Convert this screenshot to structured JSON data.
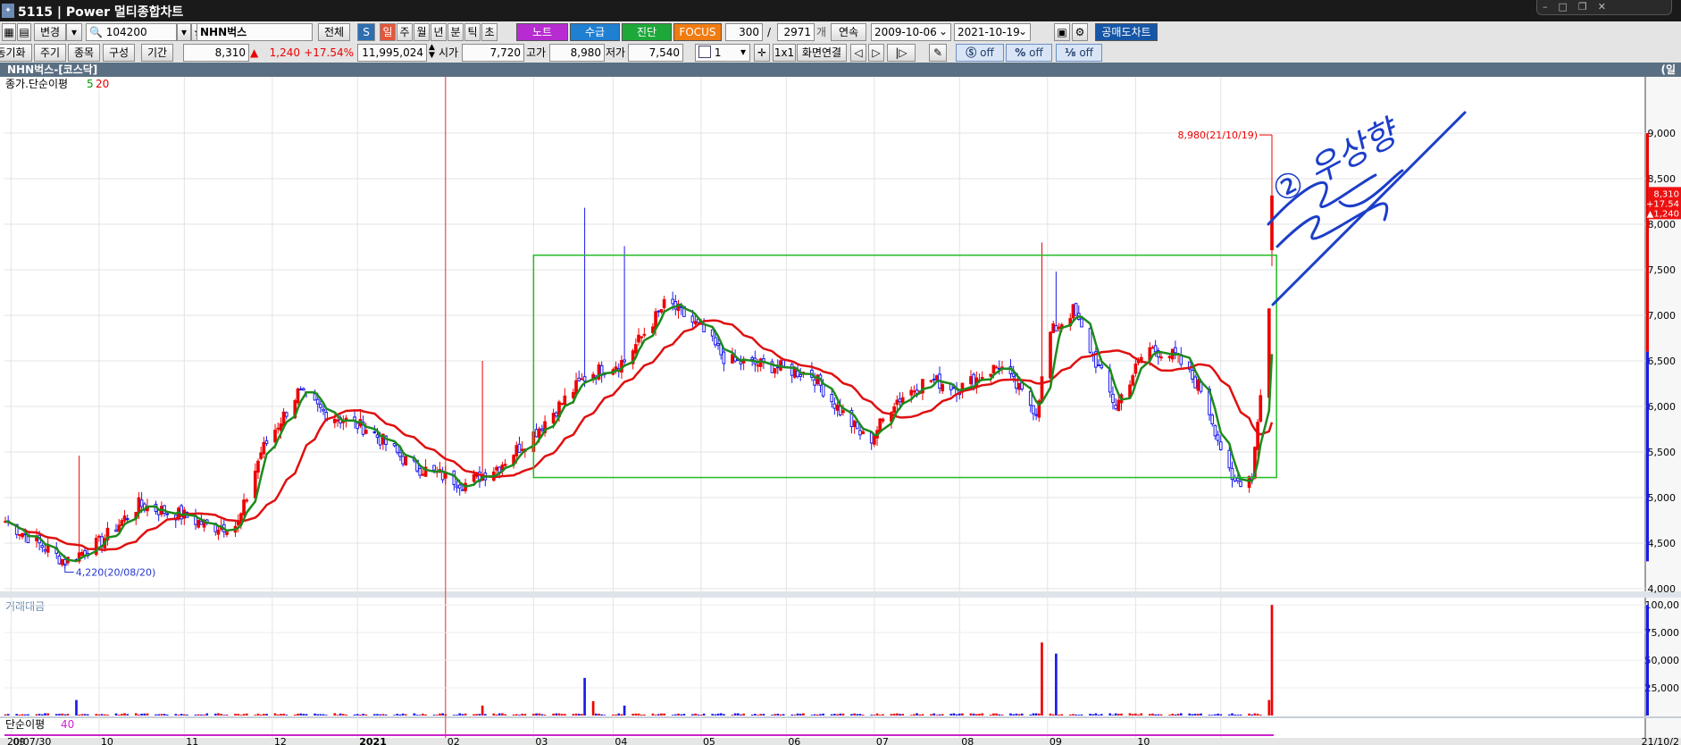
{
  "window": {
    "id": "5115",
    "title": "Power 멀티종합차트"
  },
  "toolbar1": {
    "change_label": "변경",
    "code": "104200",
    "name": "NHN벅스",
    "all_label": "전체",
    "periods": [
      "일",
      "주",
      "월",
      "년",
      "분",
      "틱",
      "초"
    ],
    "note_label": "노트",
    "supply_label": "수급",
    "diag_label": "진단",
    "focus_label": "FOCUS",
    "count": "300",
    "slash": "/",
    "total": "2971",
    "count_unit": "개",
    "continuous_label": "연속",
    "date_from": "2009-10-06",
    "date_to": "2021-10-19",
    "short_sell_label": "공매도차트"
  },
  "toolbar2": {
    "sync_label": "동기화",
    "cycle_label": "주기",
    "stock_label": "종목",
    "compose_label": "구성",
    "period_label": "기간",
    "price": "8,310",
    "change_arrow": "▲",
    "change": "1,240",
    "change_pct": "+17.54%",
    "volume": "11,995,024",
    "open_label": "시가",
    "open": "7,720",
    "high_label": "고가",
    "high": "8,980",
    "low_label": "저가",
    "low": "7,540",
    "spin_value": "1",
    "ratio_label": "1x1",
    "screen_link_label": "화면연결",
    "off1": "off",
    "off2": "off",
    "off3": "off"
  },
  "panel_title": "NHN벅스-[코스닥]",
  "panel_title_right": "(일",
  "chart_data": {
    "type": "candlestick",
    "main_legend": {
      "name": "종가.단순이평",
      "p1": "5",
      "p2": "20",
      "p1_color": "#009900",
      "p2_color": "#ee0000"
    },
    "volume_legend": "거래대금",
    "bottom_legend": {
      "name": "단순이평",
      "p": "40"
    },
    "high_annotation": "8,980(21/10/19)",
    "low_annotation": "4,220(20/08/20)",
    "current_tag": [
      "8,310",
      "+17.54",
      "▲1,240"
    ],
    "y_ticks": [
      "9,000",
      "8,500",
      "8,000",
      "7,500",
      "7,000",
      "6,500",
      "6,000",
      "5,500",
      "5,000",
      "4,500",
      "4,000"
    ],
    "y_tick_values": [
      9000,
      8500,
      8000,
      7500,
      7000,
      6500,
      6000,
      5500,
      5000,
      4500,
      4000
    ],
    "ylim": [
      4000,
      9500
    ],
    "vol_ticks": [
      "100,00",
      "75,000",
      "50,000",
      "25,000"
    ],
    "vol_tick_values": [
      100000,
      75000,
      50000,
      25000
    ],
    "x_labels": [
      "20/07/30",
      "09",
      "10",
      "11",
      "12",
      "2021",
      "02",
      "03",
      "04",
      "05",
      "06",
      "07",
      "08",
      "09",
      "10",
      "21/10/2"
    ],
    "handwriting": "② 우상향",
    "colors": {
      "up": "#ee0000",
      "down": "#1a1aee",
      "ma5": "#1d8a1d",
      "ma20": "#e01010",
      "box": "#22bb22",
      "ink": "#1c3ec8"
    },
    "close_anchors": [
      [
        "20/07/30",
        4740
      ],
      [
        "20/08/20",
        4300
      ],
      [
        "20/09/01",
        4500
      ],
      [
        "20/09/15",
        4920
      ],
      [
        "20/10/01",
        4800
      ],
      [
        "20/10/10",
        4680
      ],
      [
        "20/10/20",
        4700
      ],
      [
        "20/10/28",
        5500
      ],
      [
        "20/11/10",
        6150
      ],
      [
        "20/11/20",
        5920
      ],
      [
        "20/12/05",
        5750
      ],
      [
        "20/12/20",
        5350
      ],
      [
        "20/12/30",
        5250
      ],
      [
        "21/01/08",
        5150
      ],
      [
        "21/01/20",
        5350
      ],
      [
        "21/02/01",
        5700
      ],
      [
        "21/02/20",
        6350
      ],
      [
        "21/03/05",
        6500
      ],
      [
        "21/03/20",
        7150
      ],
      [
        "21/04/01",
        6850
      ],
      [
        "21/04/10",
        6500
      ],
      [
        "21/04/25",
        6450
      ],
      [
        "21/05/10",
        6350
      ],
      [
        "21/05/20",
        5950
      ],
      [
        "21/05/30",
        5600
      ],
      [
        "21/06/08",
        6050
      ],
      [
        "21/06/20",
        6300
      ],
      [
        "21/07/01",
        6200
      ],
      [
        "21/07/15",
        6450
      ],
      [
        "21/07/28",
        5950
      ],
      [
        "21/08/02",
        6800
      ],
      [
        "21/08/10",
        7050
      ],
      [
        "21/08/25",
        6000
      ],
      [
        "21/09/05",
        6650
      ],
      [
        "21/09/15",
        6550
      ],
      [
        "21/09/25",
        6150
      ],
      [
        "21/10/05",
        5150
      ],
      [
        "21/10/12",
        5250
      ],
      [
        "21/10/18",
        7070
      ],
      [
        "21/10/19",
        8310
      ]
    ],
    "volume_spikes": [
      [
        "21/02/19",
        34000
      ],
      [
        "21/02/22",
        13000
      ],
      [
        "21/03/05",
        9000
      ],
      [
        "21/07/30",
        66000
      ],
      [
        "21/08/04",
        56000
      ],
      [
        "21/10/18",
        14000
      ],
      [
        "21/10/19",
        100000
      ]
    ]
  }
}
